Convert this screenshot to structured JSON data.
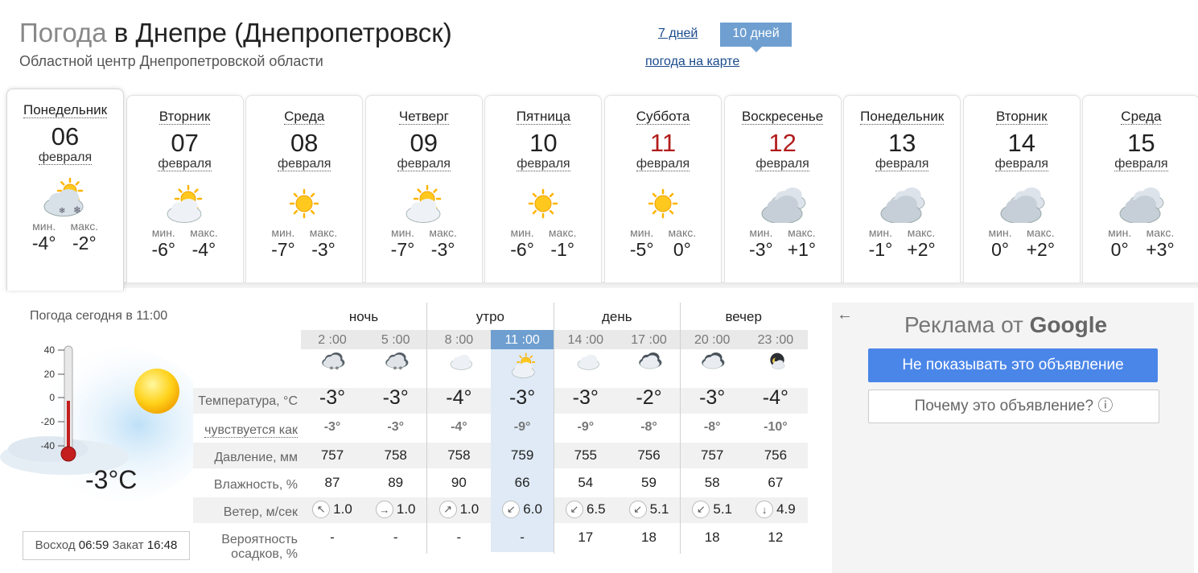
{
  "header": {
    "title_prefix": "Погода",
    "title_main": "в Днепре (Днепропетровск)",
    "subtitle": "Областной центр Днепропетровской области",
    "link_7days": "7 дней",
    "btn_10days": "10 дней",
    "link_map": "погода на карте"
  },
  "days": [
    {
      "name": "Понедельник",
      "num": "06",
      "month": "февраля",
      "icon": "partly-cloudy-snow-icon",
      "min_label": "мин.",
      "max_label": "макс.",
      "min": "-4°",
      "max": "-2°",
      "weekend": false
    },
    {
      "name": "Вторник",
      "num": "07",
      "month": "февраля",
      "icon": "partly-cloudy-icon",
      "min_label": "мин.",
      "max_label": "макс.",
      "min": "-6°",
      "max": "-4°",
      "weekend": false
    },
    {
      "name": "Среда",
      "num": "08",
      "month": "февраля",
      "icon": "sun-icon",
      "min_label": "мин.",
      "max_label": "макс.",
      "min": "-7°",
      "max": "-3°",
      "weekend": false
    },
    {
      "name": "Четверг",
      "num": "09",
      "month": "февраля",
      "icon": "partly-cloudy-icon",
      "min_label": "мин.",
      "max_label": "макс.",
      "min": "-7°",
      "max": "-3°",
      "weekend": false
    },
    {
      "name": "Пятница",
      "num": "10",
      "month": "февраля",
      "icon": "sun-icon",
      "min_label": "мин.",
      "max_label": "макс.",
      "min": "-6°",
      "max": "-1°",
      "weekend": false
    },
    {
      "name": "Суббота",
      "num": "11",
      "month": "февраля",
      "icon": "sun-icon",
      "min_label": "мин.",
      "max_label": "макс.",
      "min": "-5°",
      "max": "0°",
      "weekend": true
    },
    {
      "name": "Воскресенье",
      "num": "12",
      "month": "февраля",
      "icon": "cloudy-icon",
      "min_label": "мин.",
      "max_label": "макс.",
      "min": "-3°",
      "max": "+1°",
      "weekend": true
    },
    {
      "name": "Понедельник",
      "num": "13",
      "month": "февраля",
      "icon": "cloudy-icon",
      "min_label": "мин.",
      "max_label": "макс.",
      "min": "-1°",
      "max": "+2°",
      "weekend": false
    },
    {
      "name": "Вторник",
      "num": "14",
      "month": "февраля",
      "icon": "cloudy-icon",
      "min_label": "мин.",
      "max_label": "макс.",
      "min": "0°",
      "max": "+2°",
      "weekend": false
    },
    {
      "name": "Среда",
      "num": "15",
      "month": "февраля",
      "icon": "cloudy-icon",
      "min_label": "мин.",
      "max_label": "макс.",
      "min": "0°",
      "max": "+3°",
      "weekend": false
    }
  ],
  "now": {
    "title": "Погода сегодня в 11:00",
    "temp": "-3°C",
    "scale": [
      "40",
      "20",
      "0",
      "-20",
      "-40"
    ],
    "sunrise_label": "Восход",
    "sunrise": "06:59",
    "sunset_label": "Закат",
    "sunset": "16:48"
  },
  "table": {
    "periods": [
      "ночь",
      "утро",
      "день",
      "вечер"
    ],
    "labels": {
      "temp": "Температура, °C",
      "feels": "чувствуется как",
      "pressure": "Давление, мм",
      "humidity": "Влажность, %",
      "wind": "Ветер, м/сек",
      "precip1": "Вероятность",
      "precip2": "осадков, %"
    },
    "hours": [
      "2 :00",
      "5 :00",
      "8 :00",
      "11 :00",
      "14 :00",
      "17 :00",
      "20 :00",
      "23 :00"
    ],
    "icons": [
      "night-cloud-snow-icon",
      "night-cloud-snow-icon",
      "cloud-icon",
      "partly-cloudy-icon",
      "cloud-icon",
      "dark-cloud-icon",
      "dark-cloud-icon",
      "moon-cloud-icon"
    ],
    "temps": [
      "-3°",
      "-3°",
      "-4°",
      "-3°",
      "-3°",
      "-2°",
      "-3°",
      "-4°"
    ],
    "feels": [
      "-3°",
      "-3°",
      "-4°",
      "-9°",
      "-9°",
      "-8°",
      "-8°",
      "-10°"
    ],
    "pressure": [
      "757",
      "758",
      "758",
      "759",
      "755",
      "756",
      "757",
      "756"
    ],
    "humidity": [
      "87",
      "89",
      "90",
      "66",
      "54",
      "59",
      "58",
      "67"
    ],
    "wind_arrows": [
      "↖",
      "→",
      "↗",
      "↙",
      "↙",
      "↙",
      "↙",
      "↓"
    ],
    "wind": [
      "1.0",
      "1.0",
      "1.0",
      "6.0",
      "6.5",
      "5.1",
      "5.1",
      "4.9"
    ],
    "precip": [
      "-",
      "-",
      "-",
      "-",
      "17",
      "18",
      "18",
      "12"
    ]
  },
  "ad": {
    "title_prefix": "Реклама от",
    "title_brand": "Google",
    "btn_hide": "Не показывать это объявление",
    "btn_why": "Почему это объявление? ⓘ",
    "back": "←"
  }
}
